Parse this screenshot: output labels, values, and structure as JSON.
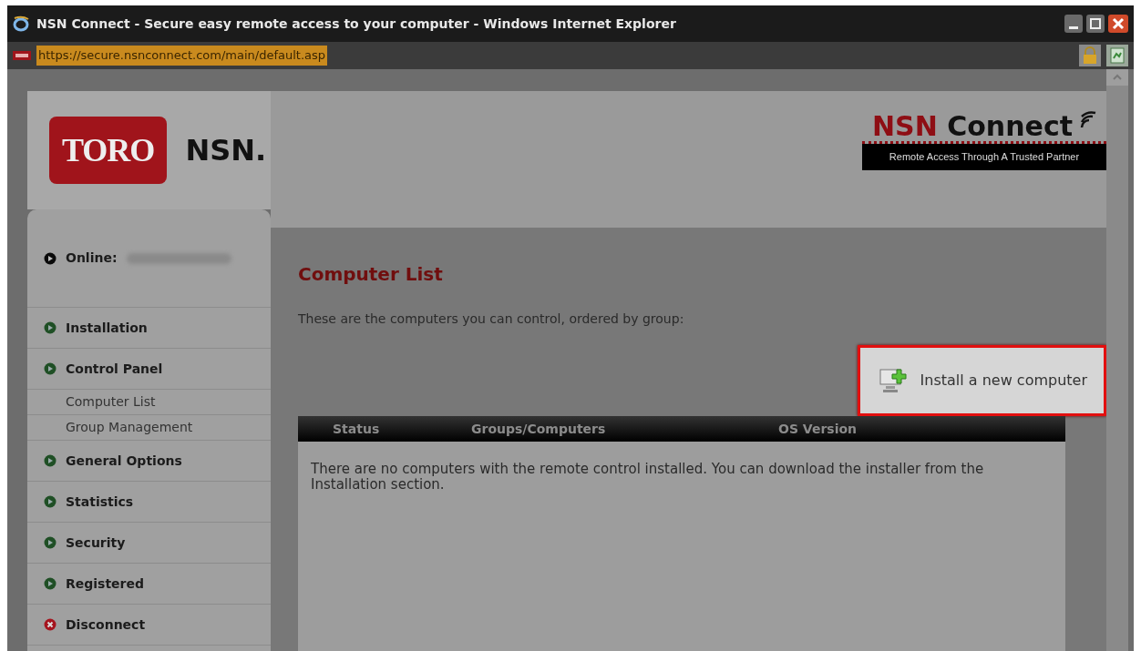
{
  "window": {
    "title": "NSN Connect - Secure easy remote access to your computer - Windows Internet Explorer"
  },
  "address_bar": {
    "url": "https://secure.nsnconnect.com/main/default.asp"
  },
  "logo": {
    "badge": "TORO",
    "name": "NSN."
  },
  "brand": {
    "first": "NSN",
    "second": "Connect",
    "tagline": "Remote Access Through A Trusted Partner"
  },
  "sidebar": {
    "items": [
      {
        "kind": "online",
        "label": "Online:"
      },
      {
        "kind": "section",
        "label": "Installation"
      },
      {
        "kind": "section",
        "label": "Control Panel"
      },
      {
        "kind": "sub",
        "label": "Computer List"
      },
      {
        "kind": "sub",
        "label": "Group Management"
      },
      {
        "kind": "section",
        "label": "General Options"
      },
      {
        "kind": "section",
        "label": "Statistics"
      },
      {
        "kind": "section",
        "label": "Security"
      },
      {
        "kind": "section",
        "label": "Registered"
      },
      {
        "kind": "exit",
        "label": "Disconnect"
      }
    ]
  },
  "main": {
    "heading": "Computer List",
    "description": "These are the computers you can control, ordered by group:",
    "install_button": "Install a new computer",
    "table": {
      "columns": [
        "Status",
        "Groups/Computers",
        "OS Version"
      ],
      "empty_message": "There are no computers with the remote control installed. You can download the installer from the Installation section."
    }
  }
}
